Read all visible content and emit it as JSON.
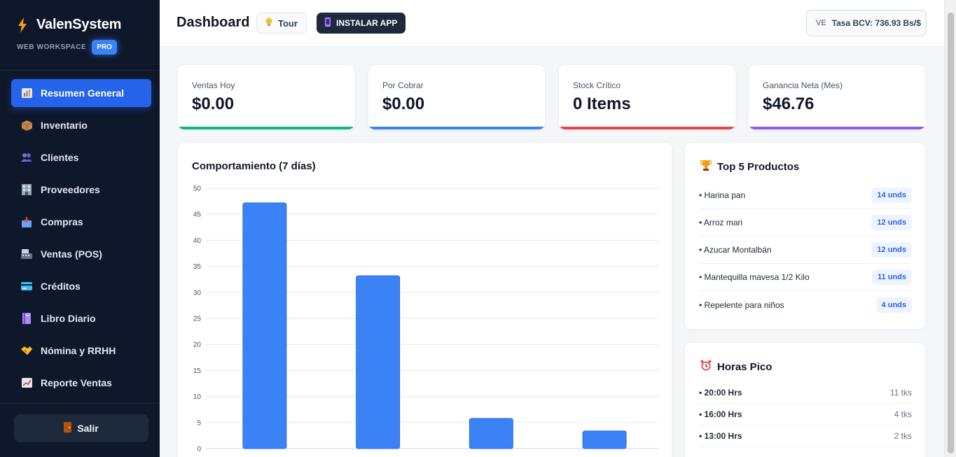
{
  "brand": {
    "name": "ValenSystem",
    "workspace": "WEB WORKSPACE",
    "badge": "PRO"
  },
  "sidebar": {
    "items": [
      {
        "label": "Resumen General",
        "icon": "bar-chart-icon",
        "active": true
      },
      {
        "label": "Inventario",
        "icon": "package-icon"
      },
      {
        "label": "Clientes",
        "icon": "users-icon"
      },
      {
        "label": "Proveedores",
        "icon": "building-icon"
      },
      {
        "label": "Compras",
        "icon": "inbox-icon"
      },
      {
        "label": "Ventas (POS)",
        "icon": "register-icon"
      },
      {
        "label": "Créditos",
        "icon": "credit-card-icon"
      },
      {
        "label": "Libro Diario",
        "icon": "notebook-icon"
      },
      {
        "label": "Nómina y RRHH",
        "icon": "handshake-icon"
      },
      {
        "label": "Reporte Ventas",
        "icon": "trend-icon"
      }
    ],
    "logout_label": "Salir"
  },
  "header": {
    "title": "Dashboard",
    "tour_label": "Tour",
    "install_label": "INSTALAR APP",
    "rate_flag": "VE",
    "rate_label": "Tasa BCV: 736.93 Bs/$"
  },
  "stats": [
    {
      "label": "Ventas Hoy",
      "value": "$0.00",
      "color": "#10b981"
    },
    {
      "label": "Por Cobrar",
      "value": "$0.00",
      "color": "#3b82f6"
    },
    {
      "label": "Stock Crítico",
      "value": "0 Items",
      "color": "#ef4444"
    },
    {
      "label": "Ganancia Neta (Mes)",
      "value": "$46.76",
      "color": "#8b5cf6"
    }
  ],
  "chart_title": "Comportamiento (7 días)",
  "chart_data": {
    "type": "bar",
    "title": "Comportamiento (7 días)",
    "values": [
      47.2,
      33.2,
      5.8,
      3.4
    ],
    "ylim": [
      0,
      50
    ],
    "yticks": [
      0,
      5,
      10,
      15,
      20,
      25,
      30,
      35,
      40,
      45,
      50
    ],
    "grid": true,
    "bar_color": "#3b82f6"
  },
  "top_products": {
    "title": "Top 5 Productos",
    "items": [
      {
        "name": "• Harina pan",
        "units": "14 unds"
      },
      {
        "name": "• Arroz mari",
        "units": "12 unds"
      },
      {
        "name": "• Azucar Montalbán",
        "units": "12 unds"
      },
      {
        "name": "• Mantequilla mavesa 1/2 Kilo",
        "units": "11 unds"
      },
      {
        "name": "• Repelente para niños",
        "units": "4 unds"
      }
    ]
  },
  "peak_hours": {
    "title": "Horas Pico",
    "items": [
      {
        "hour": "• 20:00 Hrs",
        "tickets": "11 tks"
      },
      {
        "hour": "• 16:00 Hrs",
        "tickets": "4 tks"
      },
      {
        "hour": "• 13:00 Hrs",
        "tickets": "2 tks"
      }
    ]
  }
}
